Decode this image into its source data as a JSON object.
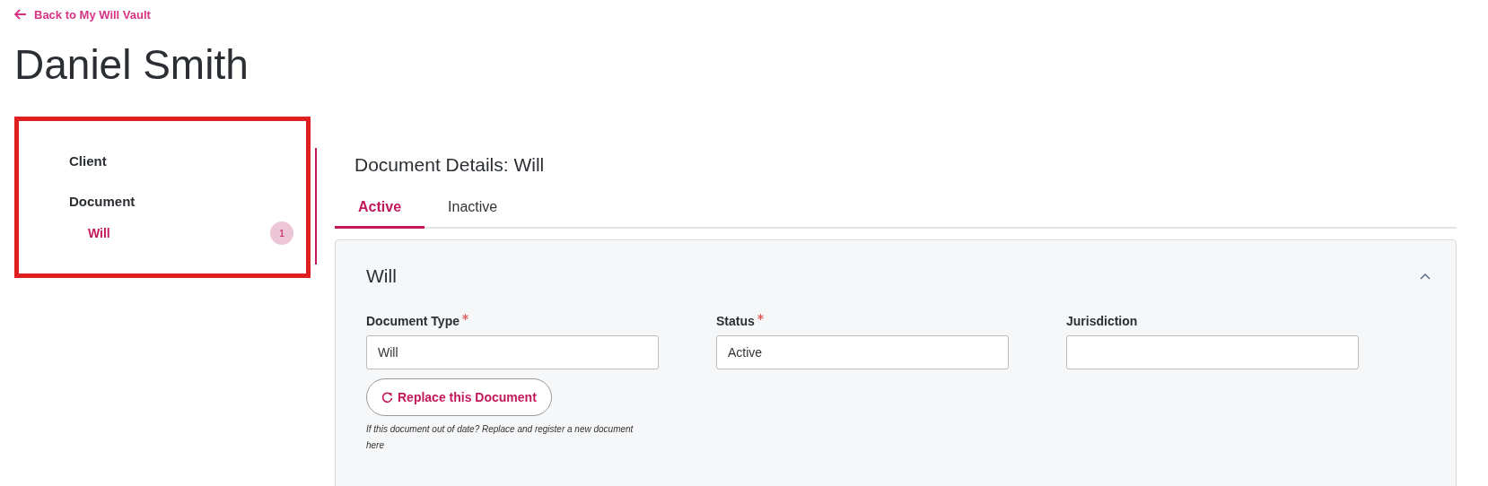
{
  "back_link": {
    "label": "Back to My Will Vault"
  },
  "title": "Daniel Smith",
  "sidebar": {
    "items": [
      {
        "label": "Client",
        "selected": false
      },
      {
        "label": "Document",
        "selected": false,
        "children": [
          {
            "label": "Will",
            "selected": true,
            "badge": "1"
          }
        ]
      }
    ]
  },
  "details": {
    "heading": "Document Details: Will",
    "tabs": [
      {
        "label": "Active",
        "selected": true
      },
      {
        "label": "Inactive",
        "selected": false
      }
    ],
    "card": {
      "title": "Will",
      "expanded": true,
      "fields": [
        {
          "label": "Document Type",
          "required": true,
          "value": "Will"
        },
        {
          "label": "Status",
          "required": true,
          "value": "Active"
        },
        {
          "label": "Jurisdiction",
          "required": false
        }
      ],
      "replace_button": {
        "label": "Replace this Document"
      },
      "help_text": "If this document out of date? Replace and register a new document here"
    }
  }
}
